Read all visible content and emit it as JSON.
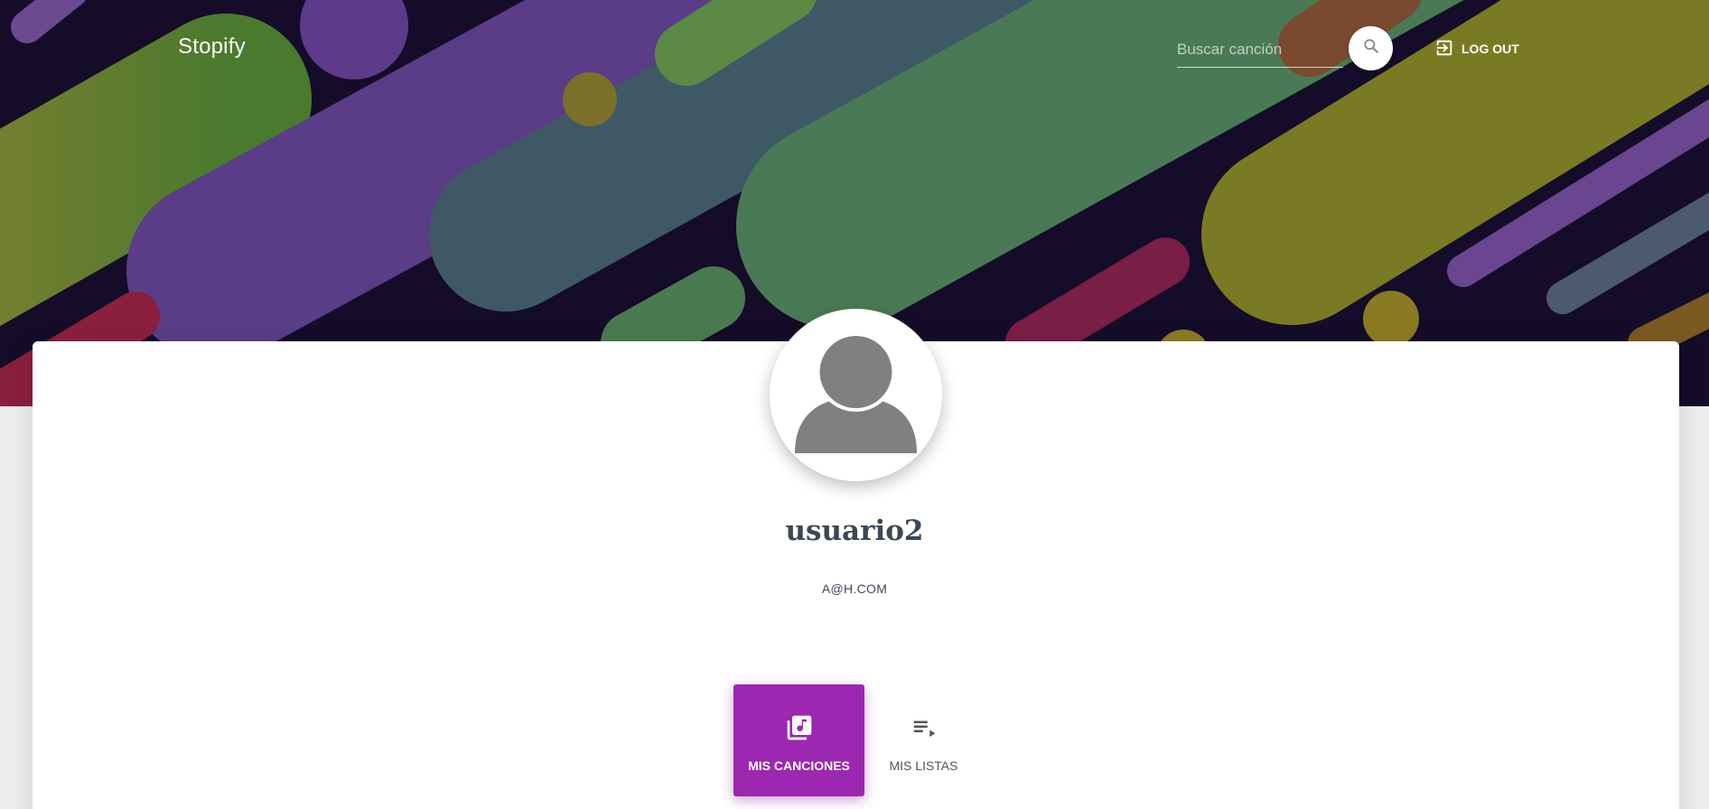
{
  "navbar": {
    "brand": "Stopify",
    "search": {
      "placeholder": "Buscar canción",
      "value": ""
    },
    "search_icon": "search-icon",
    "logout_label": "LOG OUT",
    "logout_icon": "exit-to-app-icon"
  },
  "profile": {
    "avatar_icon": "person-icon",
    "username": "usuario2",
    "email": "A@H.COM"
  },
  "tabs": [
    {
      "label": "MIS CANCIONES",
      "icon": "library-music-icon",
      "active": true
    },
    {
      "label": "MIS LISTAS",
      "icon": "playlist-play-icon",
      "active": false
    }
  ],
  "colors": {
    "accent": "#9c27b0",
    "banner_bg": "#140c28",
    "text_dark": "#3c4858"
  }
}
